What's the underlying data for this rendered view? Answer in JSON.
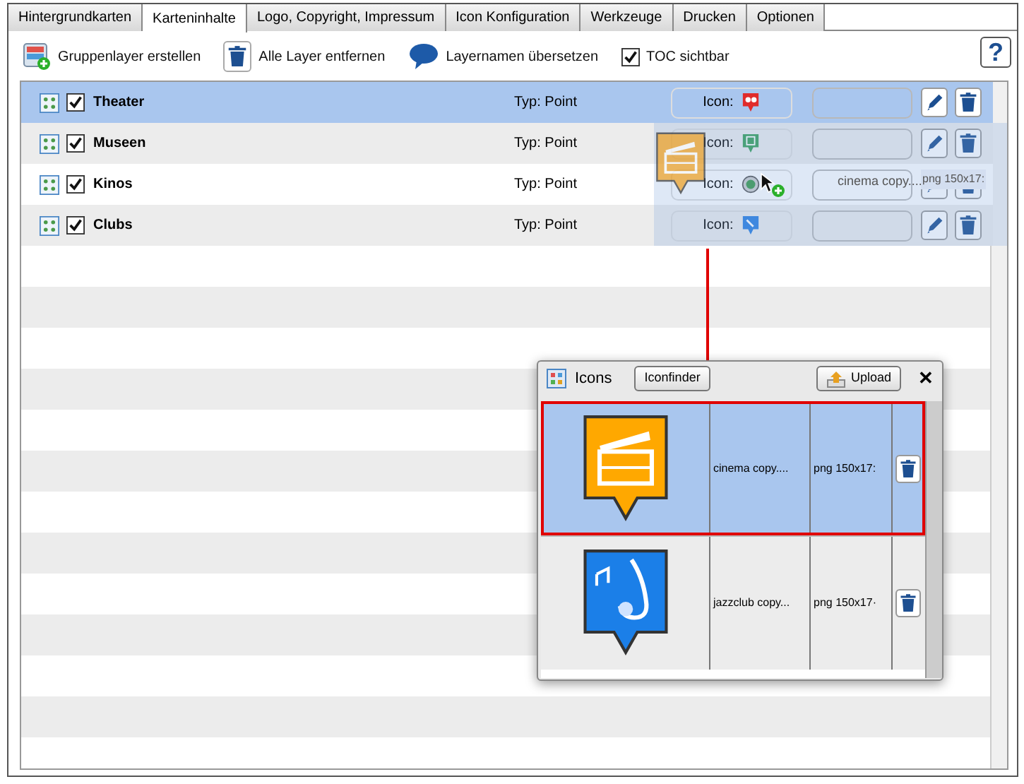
{
  "tabs": [
    {
      "label": "Hintergrundkarten",
      "selected": false
    },
    {
      "label": "Karteninhalte",
      "selected": true
    },
    {
      "label": "Logo, Copyright, Impressum",
      "selected": false
    },
    {
      "label": "Icon Konfiguration",
      "selected": false
    },
    {
      "label": "Werkzeuge",
      "selected": false
    },
    {
      "label": "Drucken",
      "selected": false
    },
    {
      "label": "Optionen",
      "selected": false
    }
  ],
  "toolbar": [
    {
      "kind": "group",
      "label": "Gruppenlayer erstellen"
    },
    {
      "kind": "remove",
      "label": "Alle Layer entfernen"
    },
    {
      "kind": "translate",
      "label": "Layernamen übersetzen"
    },
    {
      "kind": "checkbox",
      "label": "TOC sichtbar",
      "checked": true
    }
  ],
  "help": "?",
  "layers": [
    {
      "name": "Theater",
      "type": "Typ: Point",
      "icon_label": "Icon:",
      "kind": "theater",
      "checked": true,
      "selected": true
    },
    {
      "name": "Museen",
      "type": "Typ: Point",
      "icon_label": "Icon:",
      "kind": "museum",
      "checked": true,
      "selected": false
    },
    {
      "name": "Kinos",
      "type": "Typ: Point",
      "icon_label": "Icon:",
      "kind": "target",
      "checked": true,
      "selected": false
    },
    {
      "name": "Clubs",
      "type": "Typ: Point",
      "icon_label": "Icon:",
      "kind": "music",
      "checked": true,
      "selected": false
    }
  ],
  "drag_preview": {
    "name": "cinema copy....",
    "format": "png 150x17:"
  },
  "icons_dialog": {
    "title": "Icons",
    "buttons": [
      {
        "kind": "plain",
        "label": "Iconfinder"
      },
      {
        "kind": "upload",
        "label": "Upload"
      }
    ],
    "close": "✕",
    "rows": [
      {
        "kind": "cinema",
        "name": "cinema copy....",
        "format": "png 150x17:",
        "selected": true
      },
      {
        "kind": "music",
        "name": "jazzclub copy...",
        "format": "png 150x17·",
        "selected": false
      }
    ]
  }
}
